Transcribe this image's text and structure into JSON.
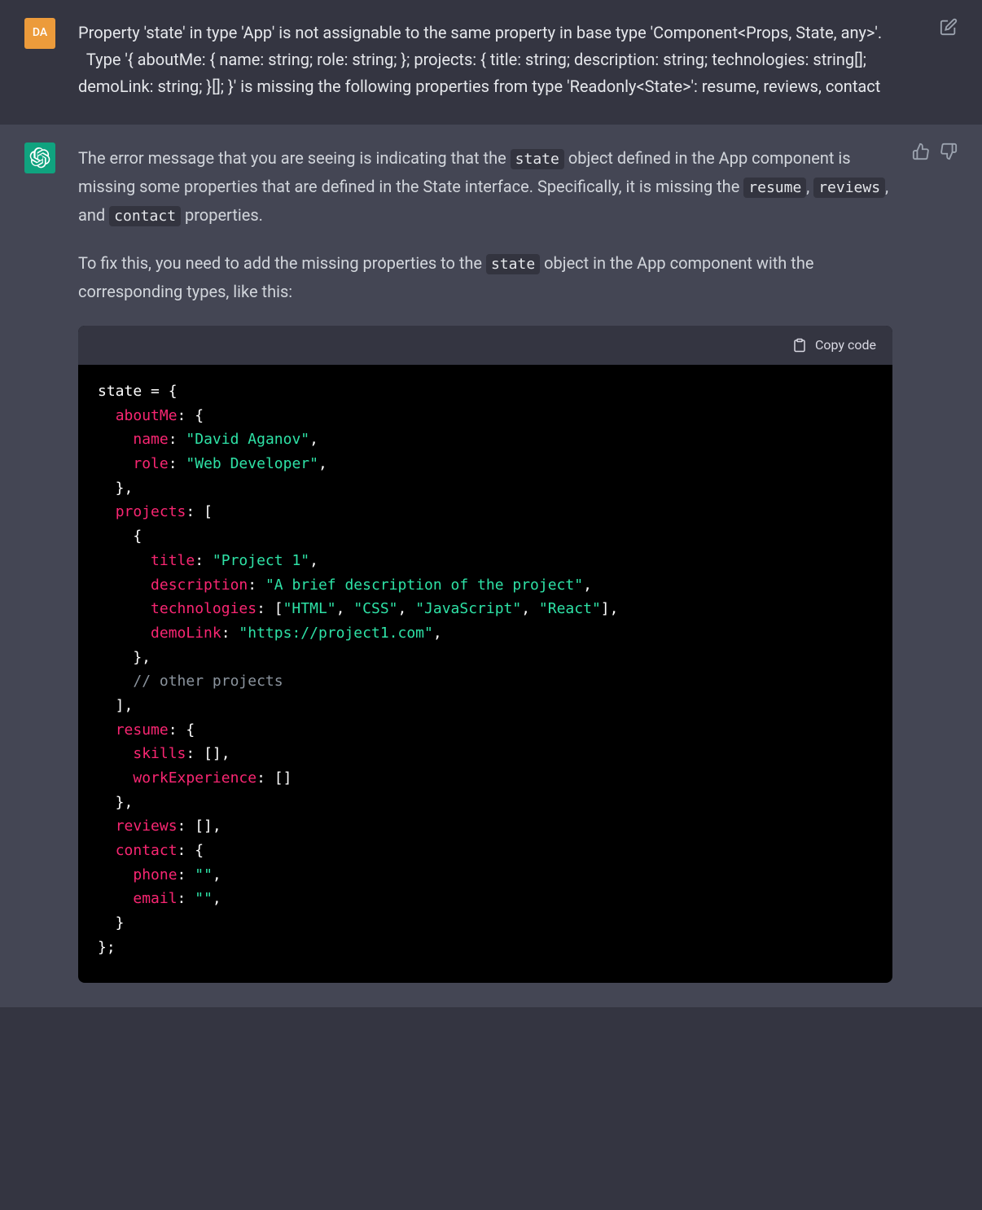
{
  "user": {
    "avatar_label": "DA",
    "message": "Property 'state' in type 'App' is not assignable to the same property in base type 'Component<Props, State, any>'.\n  Type '{ aboutMe: { name: string; role: string; }; projects: { title: string; description: string; technologies: string[]; demoLink: string; }[]; }' is missing the following properties from type 'Readonly<State>': resume, reviews, contact"
  },
  "assistant": {
    "para1_pre": "The error message that you are seeing is indicating that the ",
    "code_state1": "state",
    "para1_post": " object defined in the App component is missing some properties that are defined in the State interface. Specifically, it is missing the ",
    "code_resume": "resume",
    "sep1": ", ",
    "code_reviews": "reviews",
    "sep2": ", and ",
    "code_contact": "contact",
    "para1_end": " properties.",
    "para2_pre": "To fix this, you need to add the missing properties to the ",
    "code_state2": "state",
    "para2_post": " object in the App component with the corresponding types, like this:"
  },
  "codeblock": {
    "copy_label": "Copy code",
    "tokens": {
      "l1_a": "state = {",
      "l2_key": "aboutMe",
      "l2_post": ": {",
      "l3_key": "name",
      "l3_sep": ": ",
      "l3_val": "\"David Aganov\"",
      "l3_end": ",",
      "l4_key": "role",
      "l4_sep": ": ",
      "l4_val": "\"Web Developer\"",
      "l4_end": ",",
      "l5": "  },",
      "l6_key": "projects",
      "l6_post": ": [",
      "l7": "    {",
      "l8_key": "title",
      "l8_sep": ": ",
      "l8_val": "\"Project 1\"",
      "l8_end": ",",
      "l9_key": "description",
      "l9_sep": ": ",
      "l9_val": "\"A brief description of the project\"",
      "l9_end": ",",
      "l10_key": "technologies",
      "l10_sep": ": [",
      "l10_v1": "\"HTML\"",
      "l10_c1": ", ",
      "l10_v2": "\"CSS\"",
      "l10_c2": ", ",
      "l10_v3": "\"JavaScript\"",
      "l10_c3": ", ",
      "l10_v4": "\"React\"",
      "l10_end": "],",
      "l11_key": "demoLink",
      "l11_sep": ": ",
      "l11_val": "\"https://project1.com\"",
      "l11_end": ",",
      "l12": "    },",
      "l13_com": "// other projects",
      "l14": "  ],",
      "l15_key": "resume",
      "l15_post": ": {",
      "l16_key": "skills",
      "l16_post": ": [],",
      "l17_key": "workExperience",
      "l17_post": ": []",
      "l18": "  },",
      "l19_key": "reviews",
      "l19_post": ": [],",
      "l20_key": "contact",
      "l20_post": ": {",
      "l21_key": "phone",
      "l21_sep": ": ",
      "l21_val": "\"\"",
      "l21_end": ",",
      "l22_key": "email",
      "l22_sep": ": ",
      "l22_val": "\"\"",
      "l22_end": ",",
      "l23": "  }",
      "l24": "};"
    }
  }
}
